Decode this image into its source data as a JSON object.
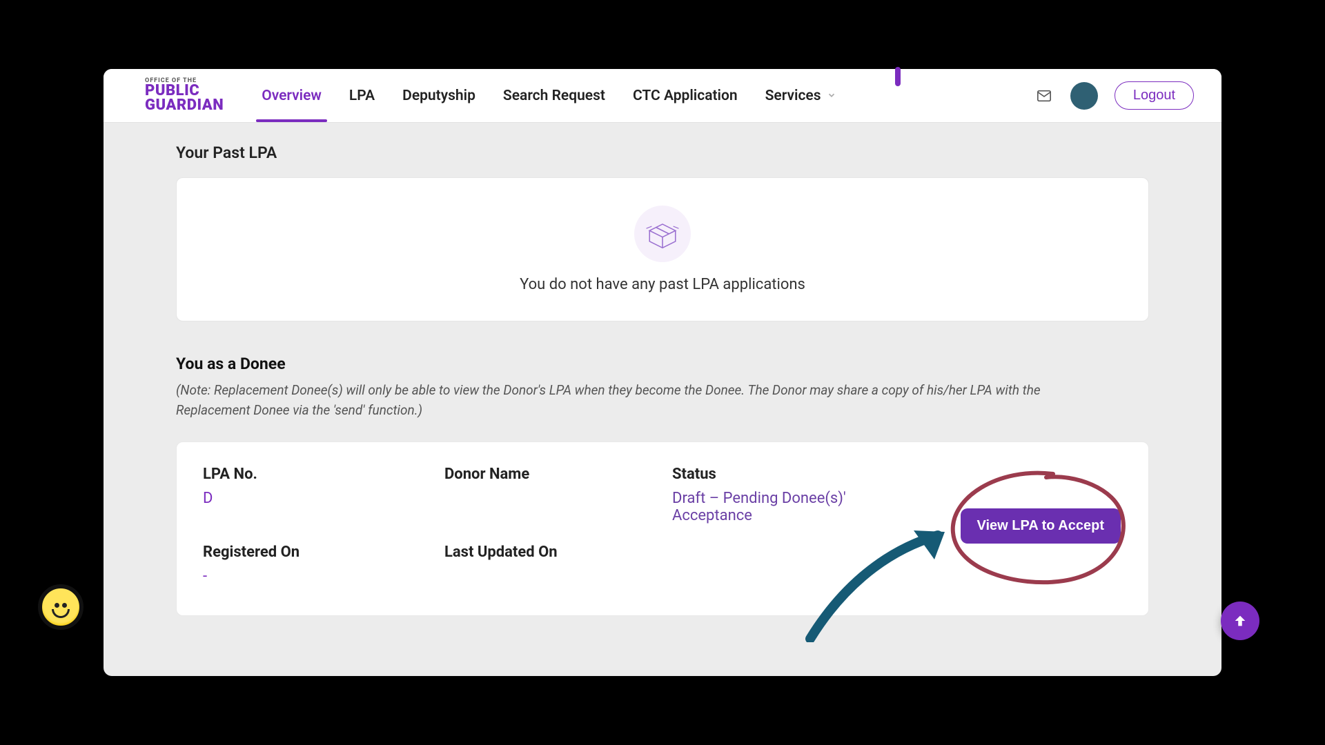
{
  "brand": {
    "small": "OFFICE OF THE",
    "line1": "PUBLIC",
    "line2": "GUARDIAN"
  },
  "nav": {
    "overview": "Overview",
    "lpa": "LPA",
    "deputyship": "Deputyship",
    "search": "Search Request",
    "ctc": "CTC Application",
    "services": "Services",
    "logout": "Logout"
  },
  "past_lpa": {
    "title": "Your Past LPA",
    "empty_text": "You do not have any past LPA applications"
  },
  "donee": {
    "title": "You as a Donee",
    "note": "(Note: Replacement Donee(s) will only be able to view the Donor's LPA when they become the Donee. The Donor may share a copy of his/her LPA with the Replacement Donee via the 'send' function.)",
    "labels": {
      "lpa_no": "LPA No.",
      "donor_name": "Donor Name",
      "status": "Status",
      "registered_on": "Registered On",
      "last_updated_on": "Last Updated On"
    },
    "values": {
      "lpa_no": "D",
      "donor_name": "",
      "status": "Draft – Pending Donee(s)' Acceptance",
      "registered_on": "-",
      "last_updated_on": ""
    },
    "view_btn": "View LPA to Accept"
  }
}
